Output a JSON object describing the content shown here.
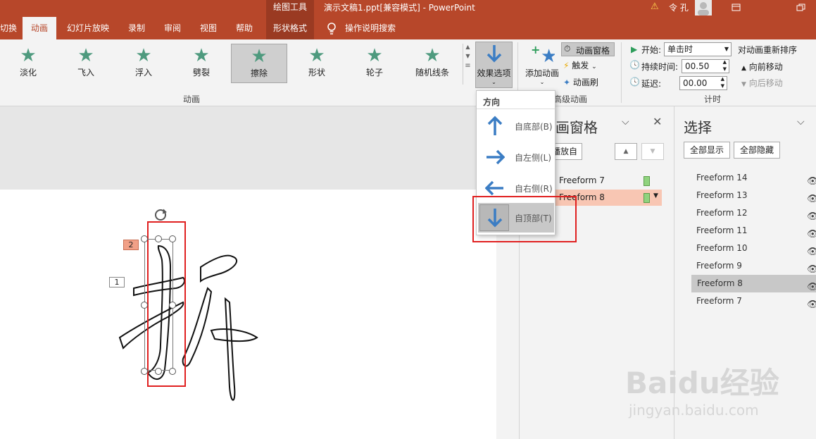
{
  "titlebar": {
    "context_tool": "绘图工具",
    "doc_title": "演示文稿1.ppt[兼容模式]  -  PowerPoint",
    "user": "令 孔",
    "warning": "⚠"
  },
  "tabs": [
    "切换",
    "动画",
    "幻灯片放映",
    "录制",
    "审阅",
    "视图",
    "帮助",
    "形状格式",
    "操作说明搜索"
  ],
  "ribbon": {
    "gallery": [
      "淡化",
      "飞入",
      "浮入",
      "劈裂",
      "擦除",
      "形状",
      "轮子",
      "随机线条"
    ],
    "effect_options": "效果选项",
    "group_anim": "动画",
    "add_anim": "添加动画",
    "anim_pane_btn": "动画窗格",
    "trigger": "触发",
    "anim_painter": "动画刷",
    "group_adv": "高级动画",
    "start_label": "开始:",
    "start_value": "单击时",
    "duration_label": "持续时间:",
    "duration_value": "00.50",
    "delay_label": "延迟:",
    "delay_value": "00.00",
    "reorder": "对动画重新排序",
    "move_earlier": "向前移动",
    "move_later": "向后移动",
    "group_timing": "计时"
  },
  "dropdown": {
    "header": "方向",
    "items": [
      "自底部(B)",
      "自左侧(L)",
      "自右侧(R)",
      "自顶部(T)"
    ]
  },
  "anim_pane": {
    "title": "画窗格",
    "play": "播放自",
    "items": [
      "Freeform 7",
      "Freeform 8"
    ]
  },
  "selection_pane": {
    "title": "选择",
    "show_all": "全部显示",
    "hide_all": "全部隐藏",
    "items": [
      "Freeform 14",
      "Freeform 13",
      "Freeform 12",
      "Freeform 11",
      "Freeform 10",
      "Freeform 9",
      "Freeform 8",
      "Freeform 7"
    ]
  },
  "slide": {
    "tag1": "1",
    "tag2": "2"
  },
  "watermark": {
    "text": "Baidu经验",
    "url": "jingyan.baidu.com"
  },
  "colors": {
    "accent": "#b7472a",
    "arrow": "#3b7dc4",
    "highlight": "#f8c6b3"
  }
}
